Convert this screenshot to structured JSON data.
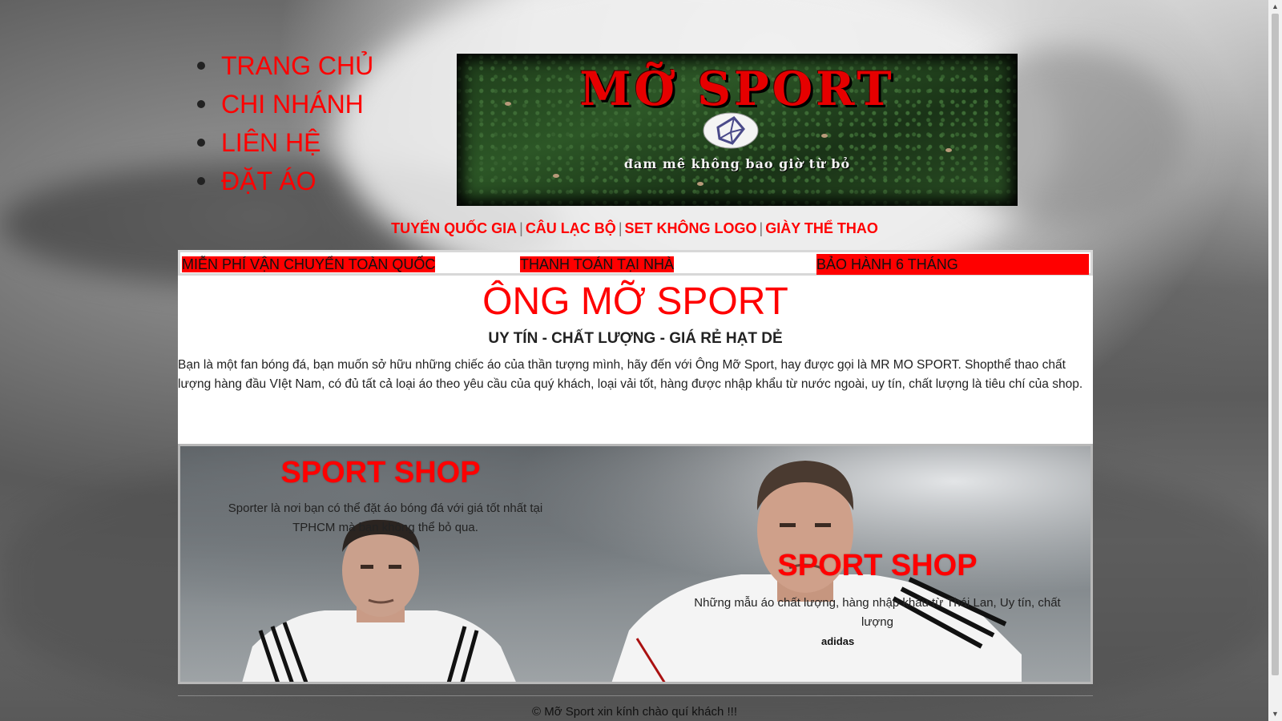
{
  "nav": {
    "items": [
      {
        "label": "TRANG CHỦ"
      },
      {
        "label": "CHI NHÁNH"
      },
      {
        "label": "LIÊN HỆ"
      },
      {
        "label": "ĐẶT ÁO"
      }
    ]
  },
  "banner": {
    "title": "MỠ SPORT",
    "tagline": "đam mê không bao giờ từ bỏ"
  },
  "categories": [
    {
      "label": "TUYỂN QUỐC GIA"
    },
    {
      "label": "CÂU LẠC BỘ"
    },
    {
      "label": "SET KHÔNG LOGO"
    },
    {
      "label": "GIÀY THỂ THAO"
    }
  ],
  "category_separator": "|",
  "info_bar": {
    "shipping": "MIỄN PHÍ VẬN CHUYỂN TOÀN QUỐC",
    "payment": "THANH TOÁN TẠI NHÀ",
    "warranty": "BẢO HÀNH 6 THÁNG"
  },
  "intro": {
    "title": "ÔNG MỠ SPORT",
    "subtitle": "UY TÍN - CHẤT LƯỢNG - GIÁ RẺ HẠT DẺ",
    "text": "Bạn là một fan bóng đá, bạn muốn sở hữu những chiếc áo của thần tượng mình, hãy đến với Ông Mỡ Sport, hay được gọi là MR MO SPORT. Shopthể thao chất lượng hàng đầu VIệt Nam, có đủ tất cả loại áo theo yêu cầu của quý khách, loại vải tốt, hàng được nhập khẩu từ nước ngoài, uy tín, chất lượng là tiêu chí của shop."
  },
  "hero": {
    "left": {
      "title": "SPORT SHOP",
      "text": "Sporter là nơi bạn có thể đặt áo bóng đá với giá tốt nhất tại TPHCM mà bạn không thể bỏ qua."
    },
    "right": {
      "title": "SPORT SHOP",
      "text": "Những mẫu áo chất lượng, hàng nhập khẩu từ Thái Lan, Uy tín, chất lượng"
    },
    "shirt_brand": "adidas"
  },
  "footer": {
    "text": "© Mỡ Sport xin kính chào quí khách !!!"
  },
  "colors": {
    "accent": "#ff0000",
    "text": "#222222",
    "info_highlight": "#ff0000"
  }
}
